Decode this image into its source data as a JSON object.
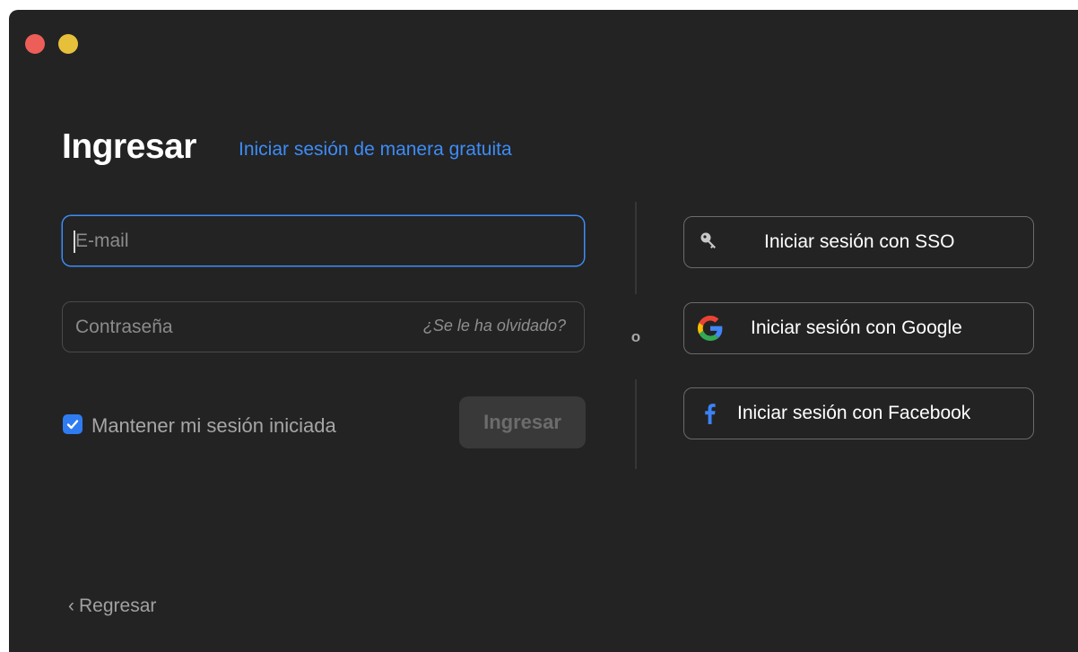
{
  "window": {
    "controls": [
      "close",
      "minimize"
    ]
  },
  "header": {
    "title": "Ingresar",
    "signup_link": "Iniciar sesión de manera gratuita"
  },
  "form": {
    "email": {
      "value": "",
      "placeholder": "E-mail"
    },
    "password": {
      "value": "",
      "placeholder": "Contraseña",
      "forgot_link": "¿Se le ha olvidado?"
    },
    "remember_me": {
      "label": "Mantener mi sesión iniciada",
      "checked": true
    },
    "submit_label": "Ingresar"
  },
  "divider": {
    "label": "o"
  },
  "sso_buttons": [
    {
      "label": "Iniciar sesión con SSO",
      "icon": "key-icon"
    },
    {
      "label": "Iniciar sesión con Google",
      "icon": "google-icon"
    },
    {
      "label": "Iniciar sesión con Facebook",
      "icon": "facebook-icon"
    }
  ],
  "footer": {
    "back_label": "Regresar",
    "back_icon": "chevron-left-icon"
  },
  "colors": {
    "background": "#232323",
    "accent": "#3d8cf7",
    "close": "#ed5e58",
    "minimize": "#e6c03b"
  }
}
